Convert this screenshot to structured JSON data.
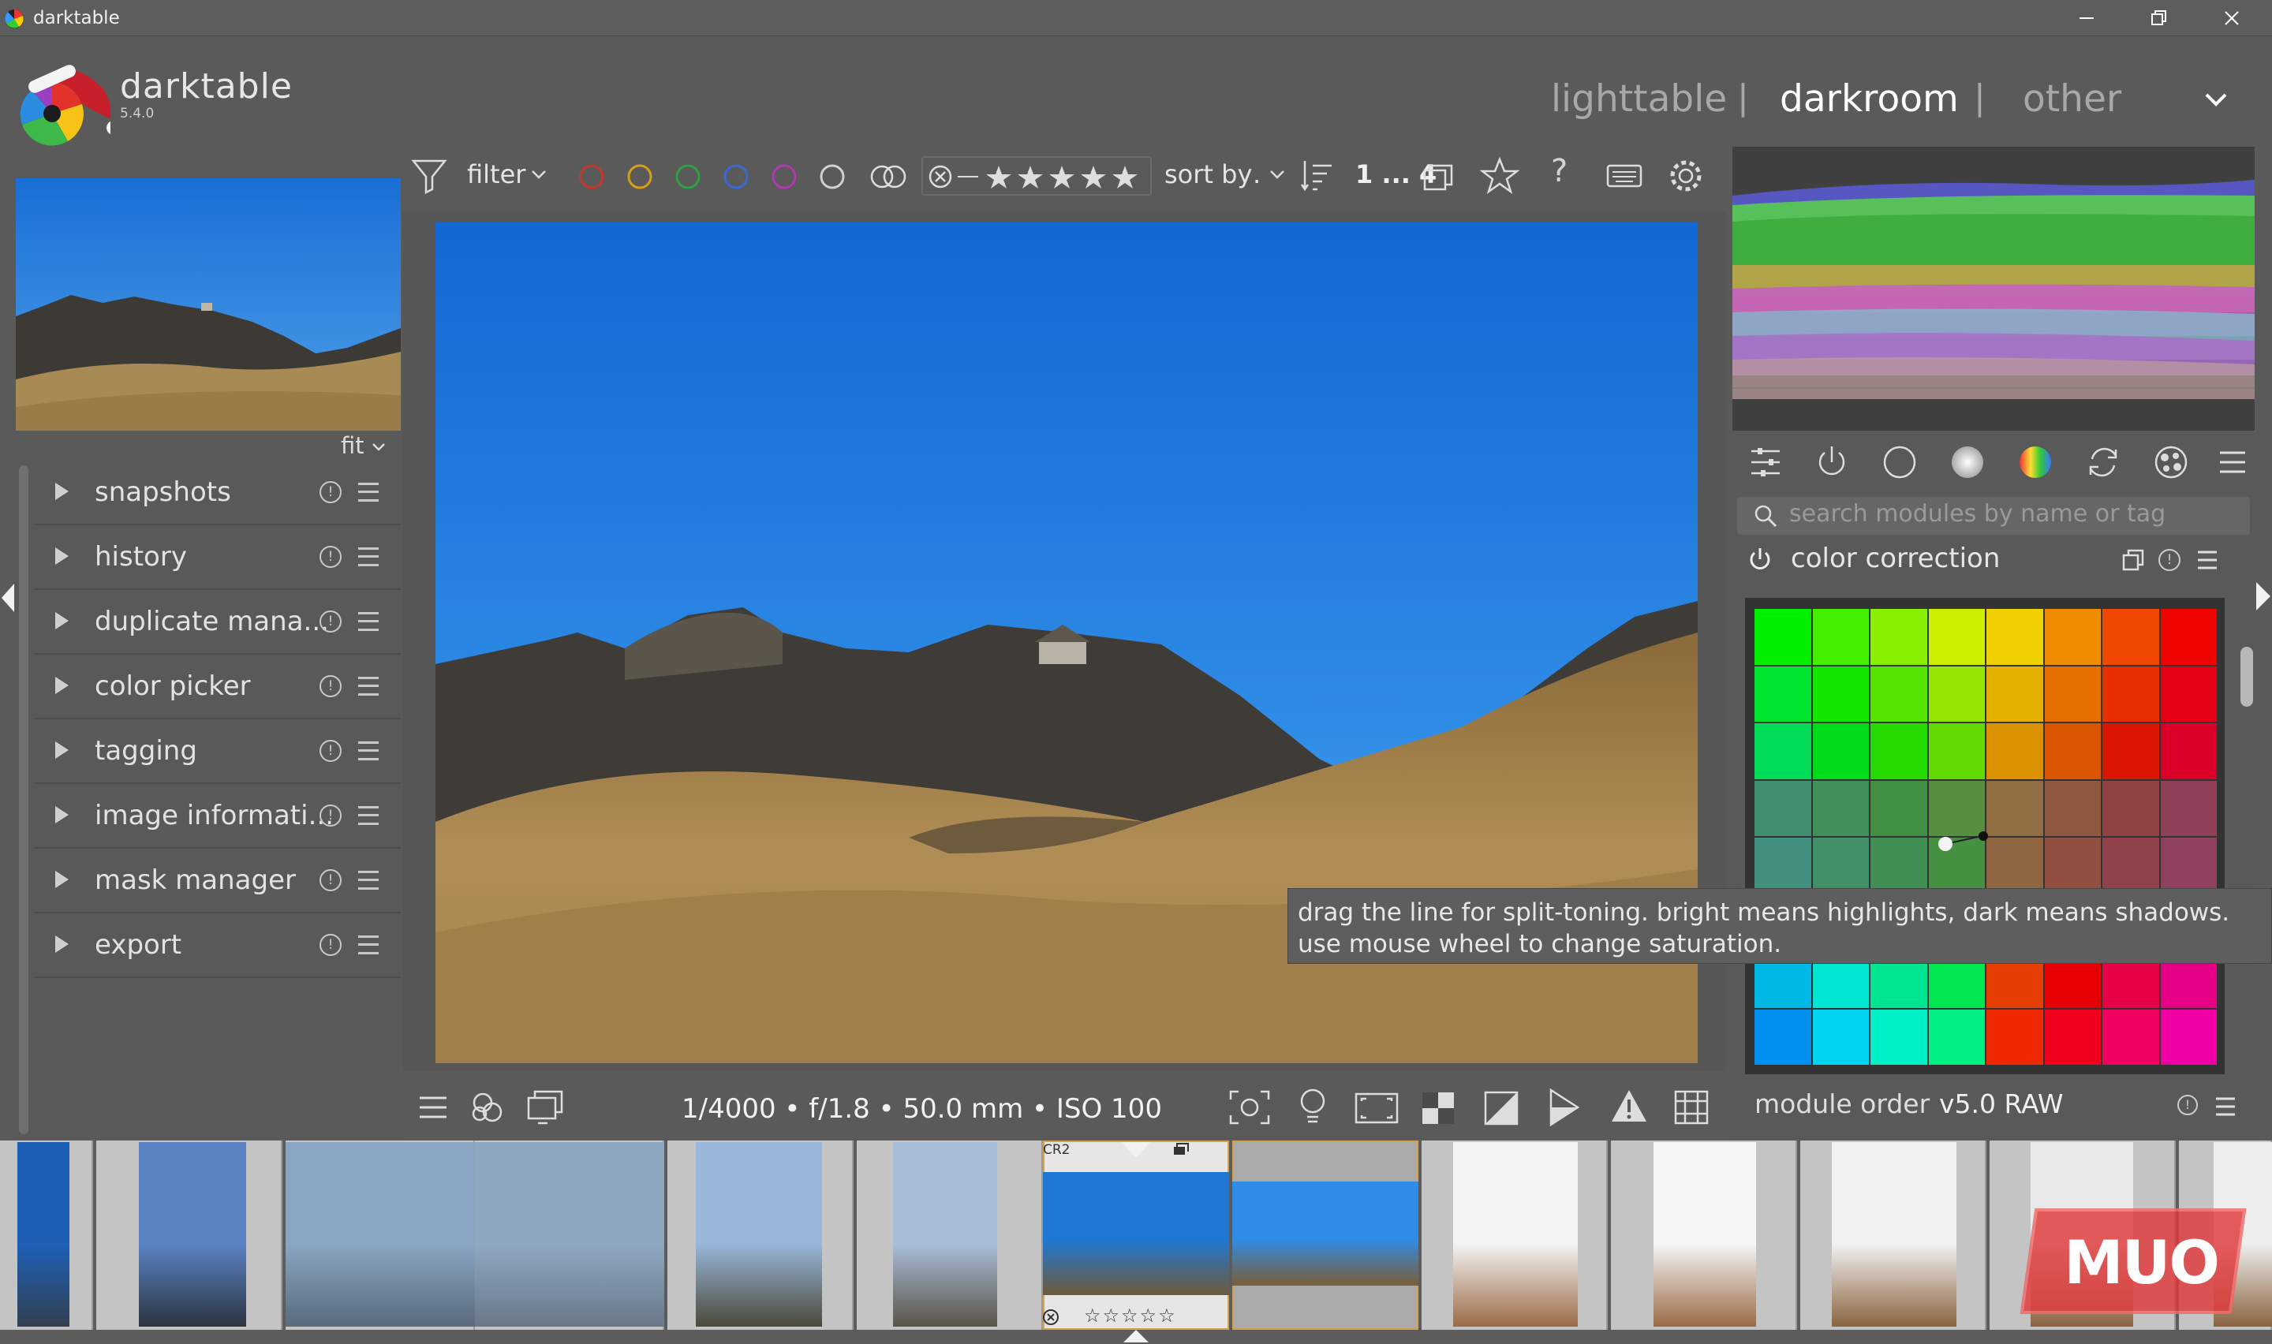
{
  "window": {
    "title": "darktable",
    "minimize_icon": "minimize-icon",
    "restore_icon": "restore-icon",
    "close_icon": "close-icon"
  },
  "header": {
    "brand": "darktable",
    "version": "5.4.0",
    "views": [
      "lighttable",
      "darkroom",
      "other"
    ],
    "separator": "|",
    "active_view": "darkroom"
  },
  "left_panel": {
    "zoom_label": "fit",
    "modules": [
      {
        "label": "snapshots"
      },
      {
        "label": "history"
      },
      {
        "label": "duplicate mana..."
      },
      {
        "label": "color picker"
      },
      {
        "label": "tagging"
      },
      {
        "label": "image informati..."
      },
      {
        "label": "mask manager"
      },
      {
        "label": "export"
      }
    ]
  },
  "toolbar": {
    "filter_label": "filter",
    "color_labels": [
      "#c0392b",
      "#d4a017",
      "#2ea043",
      "#3a6bd4",
      "#b03ab0",
      "#d0d0d0"
    ],
    "sort_label": "sort by",
    "sort_value": ".",
    "count_label": "1 ... 4"
  },
  "image_info": {
    "exif": "1/4000 • f/1.8 • 50.0 mm • ISO 100"
  },
  "right_panel": {
    "search_placeholder": "search modules by name or tag",
    "module_title": "color correction",
    "tooltip": "drag the line for split-toning. bright means highlights, dark means shadows. use mouse wheel to change saturation.",
    "module_order_label": "module order",
    "module_order_value": "v5.0 RAW"
  },
  "filmstrip": {
    "active_format": "CR2",
    "active_stars": "☆☆☆☆☆"
  },
  "watermark": {
    "text": "MUO"
  }
}
